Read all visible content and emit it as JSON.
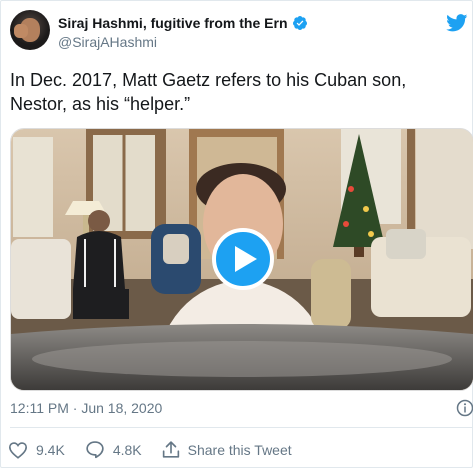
{
  "author": {
    "display_name": "Siraj Hashmi, fugitive from the Ern",
    "handle": "@SirajAHashmi",
    "verified": true
  },
  "tweet": {
    "text": "In Dec. 2017, Matt Gaetz refers to his Cuban son, Nestor, as his “helper.”",
    "timestamp": "12:11 PM · Jun 18, 2020"
  },
  "media": {
    "type": "video",
    "play_icon": "play-icon"
  },
  "actions": {
    "likes": "9.4K",
    "replies": "4.8K",
    "share_label": "Share this Tweet"
  },
  "colors": {
    "accent": "#1da1f2",
    "muted": "#657786",
    "text": "#14171a"
  }
}
